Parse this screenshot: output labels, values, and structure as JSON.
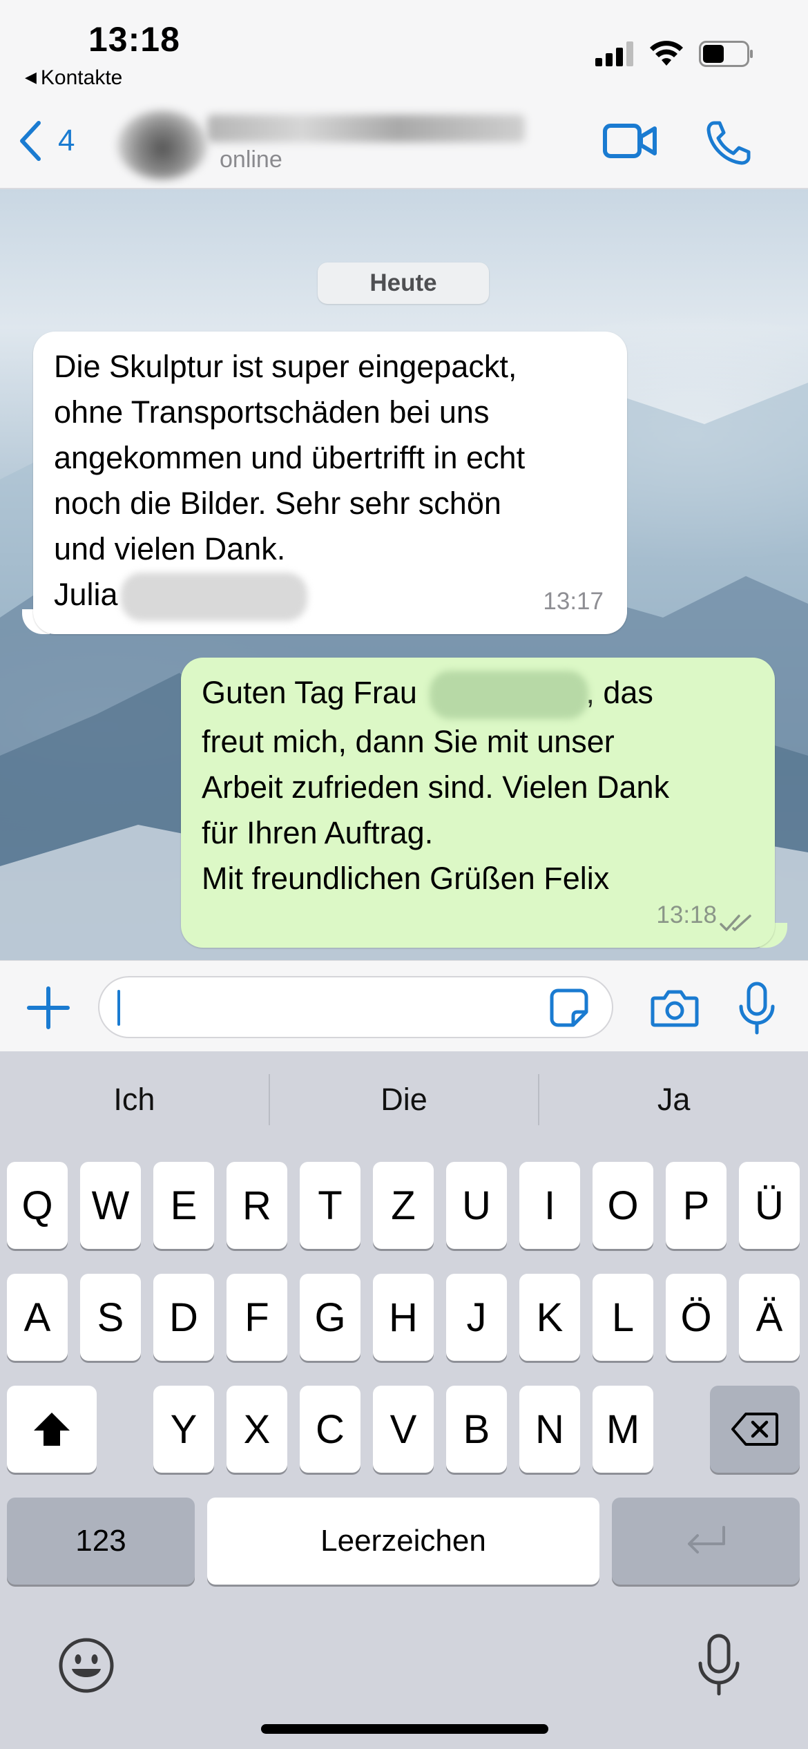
{
  "status_bar": {
    "time": "13:18",
    "back_app": "Kontakte",
    "icons": [
      "signal-icon",
      "wifi-icon",
      "battery-icon"
    ]
  },
  "header": {
    "unread_count": "4",
    "contact_status": "online",
    "icons": [
      "back-chevron-icon",
      "video-call-icon",
      "phone-icon"
    ],
    "accent_color": "#1a7bd1"
  },
  "chat": {
    "date_label": "Heute",
    "messages": [
      {
        "direction": "incoming",
        "lines": [
          "Die Skulptur ist super eingepackt,",
          "ohne Transportschäden bei uns",
          "angekommen und übertrifft in echt",
          "noch die Bilder. Sehr sehr schön",
          "und vielen Dank.",
          "Julia"
        ],
        "time": "13:17"
      },
      {
        "direction": "outgoing",
        "line1_start": "Guten Tag Frau",
        "line1_end": ", das",
        "lines": [
          "freut mich, dann Sie mit unser",
          "Arbeit zufrieden sind. Vielen Dank",
          "für Ihren Auftrag.",
          "Mit freundlichen Grüßen Felix"
        ],
        "time": "13:18",
        "status": "read"
      }
    ],
    "incoming_bubble_color": "#ffffff",
    "outgoing_bubble_color": "#dcf8c6"
  },
  "input": {
    "value": "",
    "icons": [
      "plus-icon",
      "sticker-icon",
      "camera-icon",
      "microphone-icon"
    ]
  },
  "keyboard": {
    "suggestions": [
      "Ich",
      "Die",
      "Ja"
    ],
    "row1": [
      "Q",
      "W",
      "E",
      "R",
      "T",
      "Z",
      "U",
      "I",
      "O",
      "P",
      "Ü"
    ],
    "row2": [
      "A",
      "S",
      "D",
      "F",
      "G",
      "H",
      "J",
      "K",
      "L",
      "Ö",
      "Ä"
    ],
    "row3": [
      "Y",
      "X",
      "C",
      "V",
      "B",
      "N",
      "M"
    ],
    "numbers_key": "123",
    "space_key": "Leerzeichen",
    "icons": [
      "shift-icon",
      "backspace-icon",
      "return-icon",
      "emoji-icon",
      "dictation-icon"
    ]
  }
}
